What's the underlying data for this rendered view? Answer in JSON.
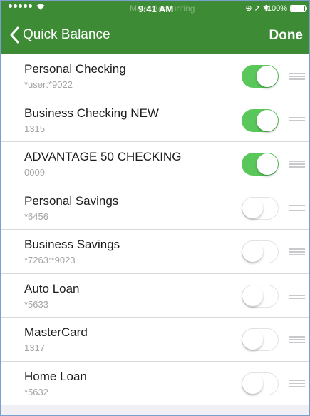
{
  "status_bar": {
    "background_title": "Move Accounting",
    "time": "9:41 AM",
    "battery": "100%",
    "icons": [
      "signal-icon",
      "wifi-icon",
      "alarm-icon",
      "location-icon",
      "bluetooth-icon",
      "battery-icon"
    ]
  },
  "navbar": {
    "back_label": "Quick Balance",
    "done_label": "Done"
  },
  "accounts": [
    {
      "name": "Personal Checking",
      "number": "*user:*9022",
      "enabled": true
    },
    {
      "name": "Business Checking NEW",
      "number": "1315",
      "enabled": true
    },
    {
      "name": "ADVANTAGE 50 CHECKING",
      "number": "0009",
      "enabled": true
    },
    {
      "name": "Personal Savings",
      "number": "*6456",
      "enabled": false
    },
    {
      "name": "Business Savings",
      "number": "*7263:*9023",
      "enabled": false
    },
    {
      "name": "Auto Loan",
      "number": "*5633",
      "enabled": false
    },
    {
      "name": "MasterCard",
      "number": "1317",
      "enabled": false
    },
    {
      "name": "Home Loan",
      "number": "*5632",
      "enabled": false
    }
  ],
  "colors": {
    "header": "#3d8c35",
    "toggle_on": "#5ac75b",
    "background": "#efeff4"
  }
}
